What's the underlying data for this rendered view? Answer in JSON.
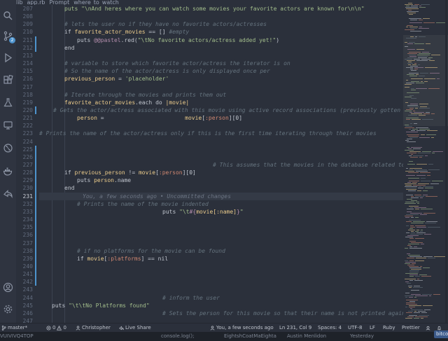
{
  "breadcrumb": {
    "items": [
      {
        "label": "lib",
        "icon": "folder-icon"
      },
      {
        "label": "app.rb",
        "icon": "ruby-file-icon"
      },
      {
        "label": "Prompt",
        "icon": "class-icon"
      },
      {
        "label": "where_to_watch",
        "icon": "method-icon"
      }
    ]
  },
  "activity_bar": {
    "items": [
      {
        "name": "search-icon"
      },
      {
        "name": "source-control-icon",
        "badge": "2"
      },
      {
        "name": "run-debug-icon"
      },
      {
        "name": "extensions-icon"
      },
      {
        "name": "testing-icon"
      },
      {
        "name": "remote-explorer-icon"
      },
      {
        "name": "git-graph-icon"
      },
      {
        "name": "docker-icon"
      },
      {
        "name": "live-share-icon"
      },
      {
        "name": "account-icon"
      },
      {
        "name": "settings-gear-icon"
      }
    ]
  },
  "editor": {
    "current_line": "231",
    "lines": [
      {
        "n": "207",
        "tokens": [
          {
            "t": "puts \"\\nAnd heres where you can watch some movies your favorite actors are known for\\n\\n\"",
            "c": "str"
          }
        ]
      },
      {
        "n": "208",
        "tokens": []
      },
      {
        "n": "209",
        "tokens": [
          {
            "t": "# lets the user no if they have no favorite actors/actresses",
            "c": "com"
          }
        ]
      },
      {
        "n": "210",
        "tokens": [
          {
            "t": "if ",
            "c": "kw"
          },
          {
            "t": "favorite_actor_movies",
            "c": "var"
          },
          {
            "t": " == [] ",
            "c": "op"
          },
          {
            "t": "#empty",
            "c": "com"
          }
        ]
      },
      {
        "n": "211",
        "tokens": [
          {
            "t": "puts ",
            "c": "kw"
          },
          {
            "t": "@@pastel",
            "c": "ivar"
          },
          {
            "t": ".red(",
            "c": "op"
          },
          {
            "t": "\"\\tNo favorite actors/actress added yet!\"",
            "c": "str"
          },
          {
            "t": ")",
            "c": "op"
          }
        ]
      },
      {
        "n": "212",
        "tokens": [
          {
            "t": "end",
            "c": "kw"
          }
        ]
      },
      {
        "n": "213",
        "tokens": []
      },
      {
        "n": "214",
        "tokens": [
          {
            "t": "# variable to store which favorite actor/actress the iterator is on",
            "c": "com"
          }
        ]
      },
      {
        "n": "215",
        "tokens": [
          {
            "t": "# So the name of the actor/actress is only displayed once per",
            "c": "com"
          }
        ]
      },
      {
        "n": "216",
        "tokens": [
          {
            "t": "previous_person",
            "c": "var"
          },
          {
            "t": " = ",
            "c": "op"
          },
          {
            "t": "'placeholder'",
            "c": "str"
          }
        ]
      },
      {
        "n": "217",
        "tokens": []
      },
      {
        "n": "218",
        "tokens": [
          {
            "t": "# Iterate through the movies and prints them out",
            "c": "com"
          }
        ]
      },
      {
        "n": "219",
        "tokens": [
          {
            "t": "favorite_actor_movies",
            "c": "var"
          },
          {
            "t": ".each ",
            "c": "op"
          },
          {
            "t": "do ",
            "c": "kw"
          },
          {
            "t": "|movie|",
            "c": "var"
          }
        ]
      },
      {
        "n": "220",
        "tokens": [
          {
            "t": "# Gets the actor/actress associated with this movie using active record associations (previously gotten when ob",
            "c": "com"
          }
        ]
      },
      {
        "n": "221",
        "tokens": [
          {
            "t": "person",
            "c": "var"
          },
          {
            "t": " =                        ",
            "c": "op"
          },
          {
            "t": "movie",
            "c": "var"
          },
          {
            "t": "[",
            "c": "op"
          },
          {
            "t": ":person",
            "c": "sym"
          },
          {
            "t": "][0]",
            "c": "op"
          }
        ]
      },
      {
        "n": "222",
        "tokens": []
      },
      {
        "n": "223",
        "tokens": [
          {
            "t": "# Prints the name of the actor/actress only if this is the first time iterating through their movies",
            "c": "com"
          }
        ]
      },
      {
        "n": "224",
        "tokens": []
      },
      {
        "n": "225",
        "tokens": []
      },
      {
        "n": "226",
        "tokens": []
      },
      {
        "n": "227",
        "tokens": [
          {
            "t": "# This assumes that the movies in the database related to a",
            "c": "com"
          }
        ]
      },
      {
        "n": "228",
        "tokens": [
          {
            "t": "if ",
            "c": "kw"
          },
          {
            "t": "previous_person",
            "c": "var"
          },
          {
            "t": " != ",
            "c": "op"
          },
          {
            "t": "movie",
            "c": "var"
          },
          {
            "t": "[",
            "c": "op"
          },
          {
            "t": ":person",
            "c": "sym"
          },
          {
            "t": "][0]",
            "c": "op"
          }
        ]
      },
      {
        "n": "229",
        "tokens": [
          {
            "t": "puts ",
            "c": "kw"
          },
          {
            "t": "person",
            "c": "var"
          },
          {
            "t": ".name",
            "c": "op"
          }
        ]
      },
      {
        "n": "230",
        "tokens": [
          {
            "t": "end",
            "c": "kw"
          }
        ]
      },
      {
        "n": "231",
        "tokens": [
          {
            "t": "You, a few seconds ago • Uncommitted changes",
            "c": "blame"
          }
        ]
      },
      {
        "n": "232",
        "tokens": [
          {
            "t": "# Prints the name of the movie indented",
            "c": "com"
          }
        ]
      },
      {
        "n": "233",
        "tokens": [
          {
            "t": "puts ",
            "c": "kw"
          },
          {
            "t": "\"\\t",
            "c": "str"
          },
          {
            "t": "#{",
            "c": "ivar"
          },
          {
            "t": "movie[:name]",
            "c": "var"
          },
          {
            "t": "}",
            "c": "ivar"
          },
          {
            "t": "\"",
            "c": "str"
          }
        ]
      },
      {
        "n": "234",
        "tokens": []
      },
      {
        "n": "235",
        "tokens": []
      },
      {
        "n": "236",
        "tokens": []
      },
      {
        "n": "237",
        "tokens": []
      },
      {
        "n": "238",
        "tokens": [
          {
            "t": "# if no platforms for the movie can be found",
            "c": "com"
          }
        ]
      },
      {
        "n": "239",
        "tokens": [
          {
            "t": "if ",
            "c": "kw"
          },
          {
            "t": "movie",
            "c": "var"
          },
          {
            "t": "[",
            "c": "op"
          },
          {
            "t": ":platforms",
            "c": "sym"
          },
          {
            "t": "] == ",
            "c": "op"
          },
          {
            "t": "nil",
            "c": "kw"
          }
        ]
      },
      {
        "n": "240",
        "tokens": []
      },
      {
        "n": "241",
        "tokens": []
      },
      {
        "n": "242",
        "tokens": []
      },
      {
        "n": "243",
        "tokens": []
      },
      {
        "n": "244",
        "tokens": [
          {
            "t": "# inform the user",
            "c": "com"
          }
        ]
      },
      {
        "n": "245",
        "tokens": [
          {
            "t": "puts ",
            "c": "kw"
          },
          {
            "t": "\"\\t\\tNo Platforms found\"",
            "c": "str"
          }
        ]
      },
      {
        "n": "246",
        "tokens": [
          {
            "t": "# Sets the person for this movie so that their name is not printed again",
            "c": "com"
          }
        ]
      },
      {
        "n": "247",
        "tokens": []
      }
    ]
  },
  "status_bar": {
    "branch": "master*",
    "errors": "0",
    "warnings": "0",
    "author": "Christopher",
    "live_share": "Live Share",
    "blame": "You, a few seconds ago",
    "position": "Ln 231, Col 9",
    "spaces": "Spaces: 4",
    "encoding": "UTF-8",
    "eol": "LF",
    "language": "Ruby",
    "formatter": "Prettier"
  },
  "behind": {
    "items": [
      "VUIVIVQ4TOP",
      "console.log();",
      "EightshCoatMaEighta",
      "Austin Menlidon",
      "Yesterday"
    ]
  },
  "tooltip": {
    "label": "bitcoute"
  },
  "colors": {
    "bg": "#2b303b",
    "comment": "#65737e",
    "keyword": "#c0c5ce",
    "variable": "#ebcb8b",
    "string": "#a3be8c",
    "symbol": "#d08770",
    "instance_var": "#b48ead",
    "accent": "#4e94ce"
  }
}
